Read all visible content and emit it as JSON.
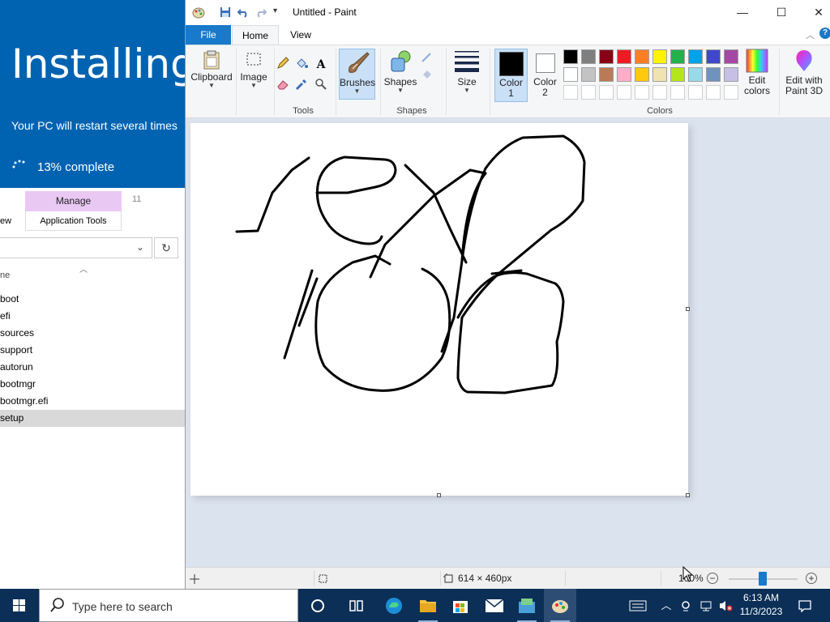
{
  "installer": {
    "title": "Installing",
    "subtitle": "Your PC will restart several times",
    "progress": "13% complete",
    "progress_percent": 13,
    "bg_color": "#0063b1"
  },
  "explorer": {
    "manage_tab": "Manage",
    "app_tools": "Application Tools",
    "view_fragment": "ew",
    "number_fragment": "11",
    "name_fragment": "ne",
    "files": [
      {
        "name": "boot",
        "selected": false
      },
      {
        "name": "efi",
        "selected": false
      },
      {
        "name": "sources",
        "selected": false
      },
      {
        "name": "support",
        "selected": false
      },
      {
        "name": "autorun",
        "selected": false
      },
      {
        "name": "bootmgr",
        "selected": false
      },
      {
        "name": "bootmgr.efi",
        "selected": false
      },
      {
        "name": "setup",
        "selected": true
      }
    ]
  },
  "paint": {
    "window_title": "Untitled - Paint",
    "tabs": {
      "file": "File",
      "home": "Home",
      "view": "View"
    },
    "ribbon": {
      "clipboard": "Clipboard",
      "image": "Image",
      "tools": "Tools",
      "brushes": "Brushes",
      "shapes": "Shapes",
      "shapes_group": "Shapes",
      "size": "Size",
      "color1": "Color 1",
      "color2": "Color 2",
      "colors": "Colors",
      "edit_colors": "Edit colors",
      "edit_paint3d": "Edit with Paint 3D",
      "color1_value": "#000000",
      "color2_value": "#ffffff"
    },
    "palette_row1": [
      "#000000",
      "#7f7f7f",
      "#880015",
      "#ed1c24",
      "#ff7f27",
      "#fff200",
      "#22b14c",
      "#00a2e8",
      "#3f48cc",
      "#a349a4"
    ],
    "palette_row2": [
      "#ffffff",
      "#c3c3c3",
      "#b97a57",
      "#ffaec9",
      "#ffc90e",
      "#efe4b0",
      "#b5e61d",
      "#99d9ea",
      "#7092be",
      "#c8bfe7"
    ],
    "status": {
      "dimensions": "614 × 460px",
      "zoom": "100%"
    }
  },
  "taskbar": {
    "search_placeholder": "Type here to search",
    "time": "6:13 AM",
    "date": "11/3/2023"
  }
}
